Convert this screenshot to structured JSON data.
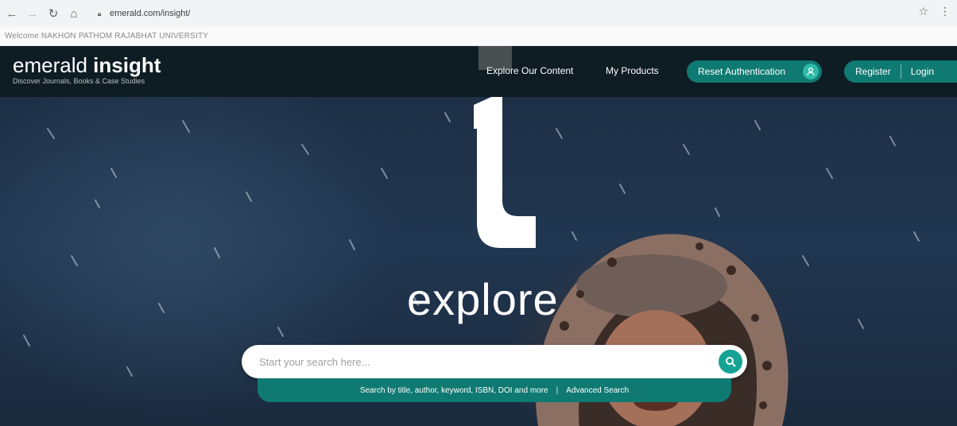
{
  "browser": {
    "url": "emerald.com/insight/",
    "back_icon": "arrow-left-icon",
    "forward_icon": "arrow-right-icon",
    "reload_icon": "reload-icon",
    "home_icon": "home-icon"
  },
  "welcome_text": "Welcome NAKHON PATHOM RAJABHAT UNIVERSITY",
  "header": {
    "logo_light": "emerald",
    "logo_bold": "insight",
    "tagline": "Discover Journals, Books & Case Studies",
    "nav": [
      "Explore Our Content",
      "My Products"
    ],
    "reset_auth": "Reset Authentication",
    "register": "Register",
    "login": "Login"
  },
  "hero": {
    "headline": "explore",
    "search_placeholder": "Start your search here...",
    "hint": "Search by title, author, keyword, ISBN, DOI and more",
    "separator": "|",
    "advanced": "Advanced Search"
  },
  "colors": {
    "header_bg": "#0e1c23",
    "accent": "#0f7a71",
    "accent_light": "#14a394"
  }
}
